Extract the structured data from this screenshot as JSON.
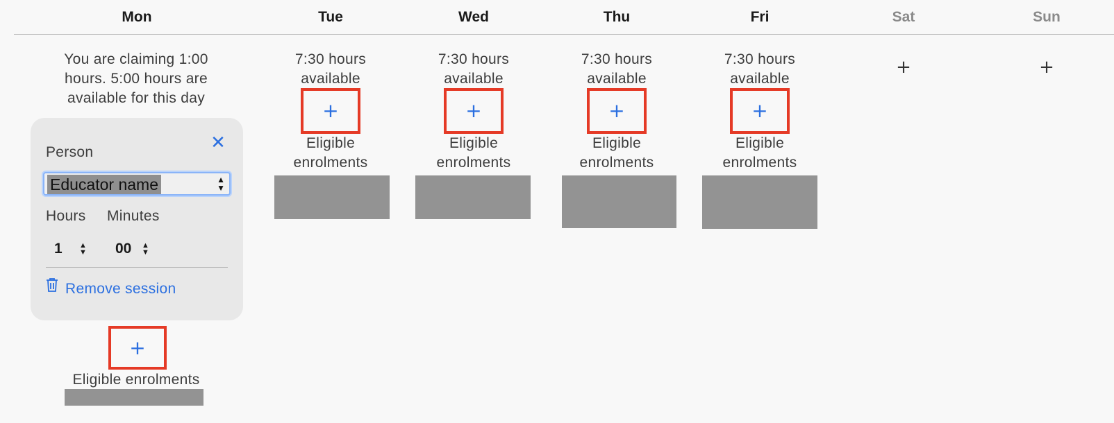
{
  "days": [
    {
      "key": "mon",
      "label": "Mon",
      "weekend": false
    },
    {
      "key": "tue",
      "label": "Tue",
      "weekend": false
    },
    {
      "key": "wed",
      "label": "Wed",
      "weekend": false
    },
    {
      "key": "thu",
      "label": "Thu",
      "weekend": false
    },
    {
      "key": "fri",
      "label": "Fri",
      "weekend": false
    },
    {
      "key": "sat",
      "label": "Sat",
      "weekend": true
    },
    {
      "key": "sun",
      "label": "Sun",
      "weekend": true
    }
  ],
  "mon": {
    "availability_text": "You are claiming 1:00 hours. 5:00 hours are available for this day",
    "add_glyph": "+",
    "eligible_label": "Eligible enrolments"
  },
  "session_card": {
    "close_glyph": "✕",
    "person_label": "Person",
    "person_value": "Educator name",
    "hours_label": "Hours",
    "minutes_label": "Minutes",
    "hours_value": "1",
    "minutes_value": "00",
    "remove_label": "Remove session"
  },
  "weekdays": {
    "tue": {
      "avail_line1": "7:30 hours",
      "avail_line2": "available",
      "add_glyph": "+",
      "eligible_line1": "Eligible",
      "eligible_line2": "enrolments"
    },
    "wed": {
      "avail_line1": "7:30 hours",
      "avail_line2": "available",
      "add_glyph": "+",
      "eligible_line1": "Eligible",
      "eligible_line2": "enrolments"
    },
    "thu": {
      "avail_line1": "7:30 hours",
      "avail_line2": "available",
      "add_glyph": "+",
      "eligible_line1": "Eligible",
      "eligible_line2": "enrolments"
    },
    "fri": {
      "avail_line1": "7:30 hours",
      "avail_line2": "available",
      "add_glyph": "+",
      "eligible_line1": "Eligible",
      "eligible_line2": "enrolments"
    }
  },
  "weekend": {
    "sat_add_glyph": "+",
    "sun_add_glyph": "+"
  },
  "colors": {
    "accent": "#2b6fe0",
    "highlight_border": "#e53a26",
    "redacted_block": "#939393",
    "weekend_header": "#8a8a8a"
  },
  "icons": {
    "close": "close-icon",
    "trash": "trash-icon",
    "add": "plus-icon",
    "select_arrows": "chevron-up-down-icon"
  }
}
